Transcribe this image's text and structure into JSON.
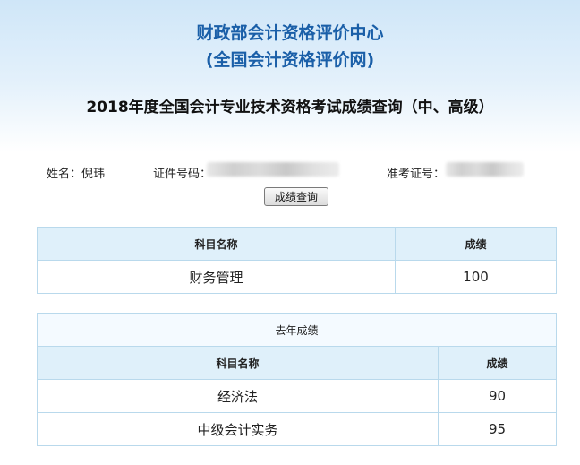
{
  "header": {
    "org_name": "财政部会计资格评价中心",
    "site_name": "(全国会计资格评价网)",
    "query_title": "2018年度全国会计专业技术资格考试成绩查询（中、高级）"
  },
  "candidate": {
    "name_label": "姓名：",
    "name_value": "倪玮",
    "id_label": "证件号码：",
    "exam_no_label": "准考证号："
  },
  "query_button": "成绩查询",
  "current_scores": {
    "headers": {
      "subject": "科目名称",
      "score": "成绩"
    },
    "rows": [
      {
        "subject": "财务管理",
        "score": "100"
      }
    ]
  },
  "last_year_scores": {
    "caption": "去年成绩",
    "headers": {
      "subject": "科目名称",
      "score": "成绩"
    },
    "rows": [
      {
        "subject": "经济法",
        "score": "90"
      },
      {
        "subject": "中级会计实务",
        "score": "95"
      }
    ]
  }
}
